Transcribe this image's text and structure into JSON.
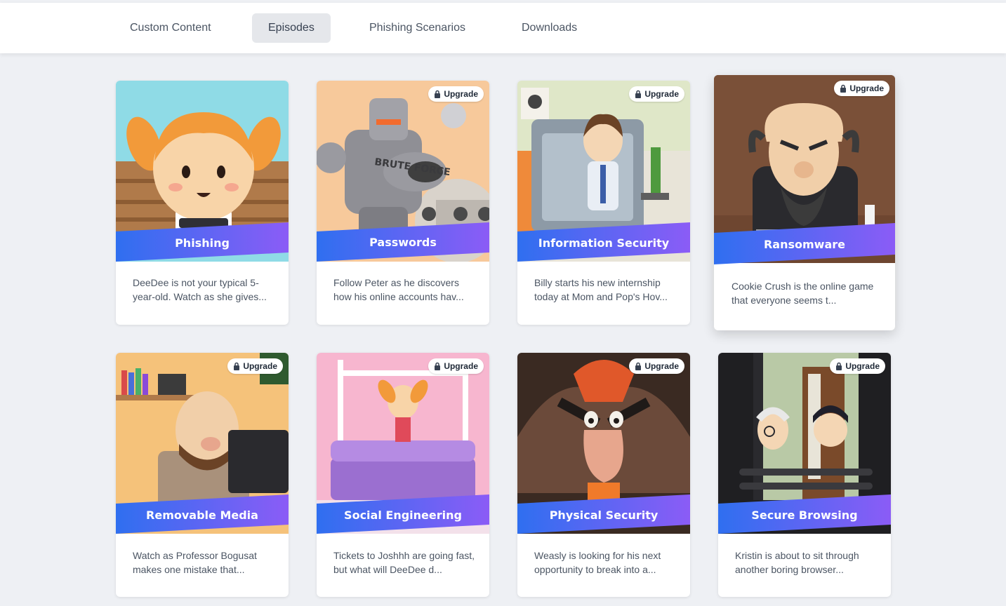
{
  "nav": {
    "tabs": [
      {
        "label": "Custom Content"
      },
      {
        "label": "Episodes"
      },
      {
        "label": "Phishing Scenarios"
      },
      {
        "label": "Downloads"
      }
    ],
    "active_tab": "Episodes"
  },
  "badge_label": "Upgrade",
  "episodes": [
    {
      "title": "Phishing",
      "description": "DeeDee is not your typical 5-year-old. Watch as she gives...",
      "locked": false
    },
    {
      "title": "Passwords",
      "description": "Follow Peter as he discovers how his online accounts hav...",
      "locked": true
    },
    {
      "title": "Information Security",
      "description": "Billy starts his new internship today at Mom and Pop's Hov...",
      "locked": true
    },
    {
      "title": "Ransomware",
      "description": "Cookie Crush is the online game that everyone seems t...",
      "locked": true
    },
    {
      "title": "Removable Media",
      "description": "Watch as Professor Bogusat makes one mistake that...",
      "locked": true
    },
    {
      "title": "Social Engineering",
      "description": "Tickets to Joshhh are going fast, but what will DeeDee d...",
      "locked": true
    },
    {
      "title": "Physical Security",
      "description": "Weasly is looking for his next opportunity to break into a...",
      "locked": true
    },
    {
      "title": "Secure Browsing",
      "description": "Kristin is about to sit through another boring browser...",
      "locked": true
    }
  ],
  "colors": {
    "banner_start": "#2f6ff0",
    "banner_end": "#8b5cf6",
    "tab_active_bg": "#e5e7eb",
    "page_bg": "#eef0f4"
  },
  "icons": {
    "lock": "lock-icon"
  }
}
